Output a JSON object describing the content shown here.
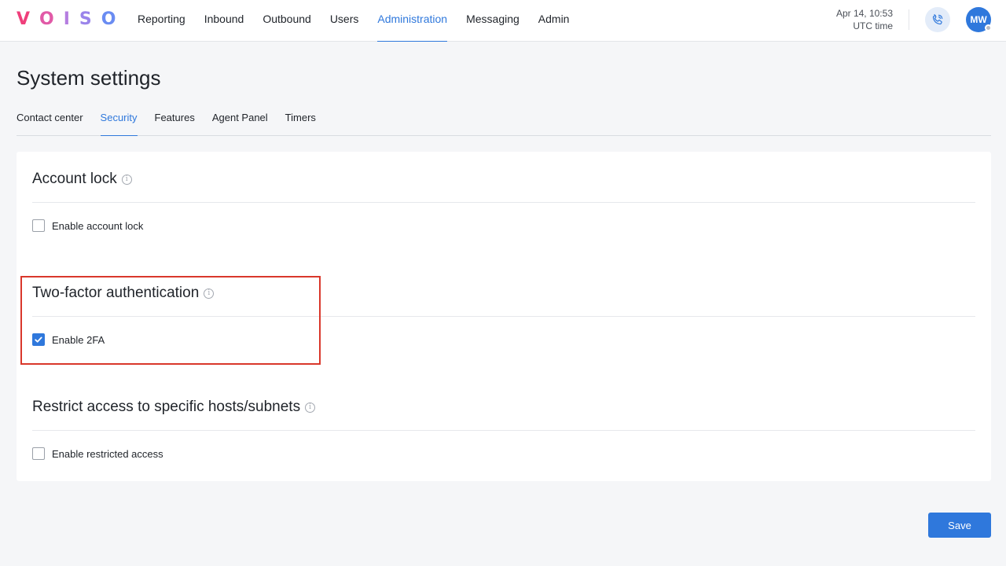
{
  "app": {
    "logo_letters": [
      "V",
      "O",
      "I",
      "S",
      "O"
    ]
  },
  "nav": {
    "items": [
      {
        "label": "Reporting",
        "active": false
      },
      {
        "label": "Inbound",
        "active": false
      },
      {
        "label": "Outbound",
        "active": false
      },
      {
        "label": "Users",
        "active": false
      },
      {
        "label": "Administration",
        "active": true
      },
      {
        "label": "Messaging",
        "active": false
      },
      {
        "label": "Admin",
        "active": false
      }
    ]
  },
  "header": {
    "datetime": "Apr 14, 10:53",
    "timezone": "UTC time",
    "call_icon": "phone-icon",
    "avatar_initials": "MW"
  },
  "page": {
    "title": "System settings",
    "tabs": [
      {
        "label": "Contact center",
        "active": false
      },
      {
        "label": "Security",
        "active": true
      },
      {
        "label": "Features",
        "active": false
      },
      {
        "label": "Agent Panel",
        "active": false
      },
      {
        "label": "Timers",
        "active": false
      }
    ]
  },
  "sections": {
    "account_lock": {
      "title": "Account lock",
      "checkbox_label": "Enable account lock",
      "checked": false
    },
    "two_factor": {
      "title": "Two-factor authentication",
      "checkbox_label": "Enable 2FA",
      "checked": true
    },
    "restrict_access": {
      "title": "Restrict access to specific hosts/subnets",
      "checkbox_label": "Enable restricted access",
      "checked": false
    }
  },
  "actions": {
    "save_label": "Save"
  },
  "colors": {
    "accent": "#2f78dc",
    "highlight_border": "#d9372b"
  }
}
